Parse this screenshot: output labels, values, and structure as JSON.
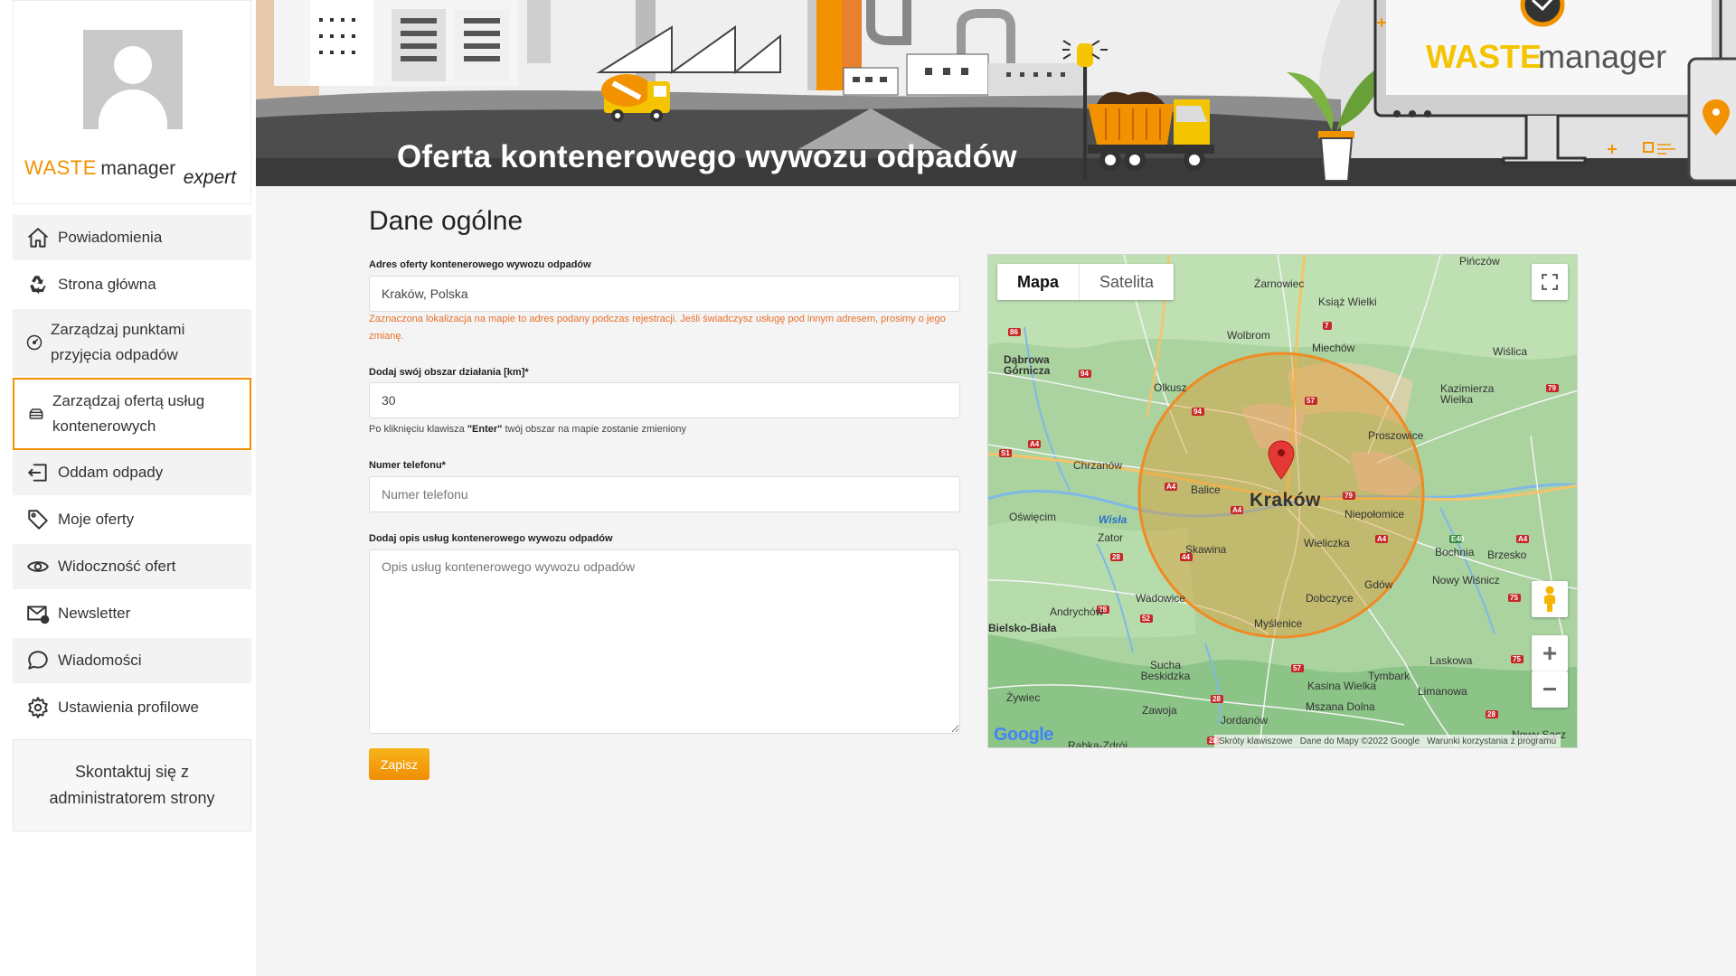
{
  "sidebar": {
    "logo": {
      "waste": "WASTE",
      "manager": "manager",
      "expert": "expert"
    },
    "items": [
      {
        "label": "Powiadomienia",
        "icon": "home-icon"
      },
      {
        "label": "Strona główna",
        "icon": "recycle-icon"
      },
      {
        "label": "Zarządzaj punktami przyjęcia odpadów",
        "icon": "gauge-icon"
      },
      {
        "label": "Zarządzaj ofertą usług kontenerowych",
        "icon": "container-icon",
        "active": true
      },
      {
        "label": "Oddam odpady",
        "icon": "box-arrow-icon"
      },
      {
        "label": "Moje oferty",
        "icon": "tag-icon"
      },
      {
        "label": "Widoczność ofert",
        "icon": "eye-icon"
      },
      {
        "label": "Newsletter",
        "icon": "envelope-icon"
      },
      {
        "label": "Wiadomości",
        "icon": "chat-bubble-icon"
      },
      {
        "label": "Ustawienia profilowe",
        "icon": "gear-icon"
      }
    ],
    "contact": "Skontaktuj się z administratorem strony"
  },
  "banner": {
    "title": "Oferta kontenerowego wywozu odpadów",
    "brand_waste": "WASTE",
    "brand_manager": "manager"
  },
  "form": {
    "section_title": "Dane ogólne",
    "address_label": "Adres oferty kontenerowego wywozu odpadów",
    "address_value": "Kraków, Polska",
    "address_note": "Zaznaczona lokalizacja na mapie to adres podany podczas rejestracji. Jeśli świadczysz usługę pod innym adresem, prosimy o jego zmianę.",
    "radius_label": "Dodaj swój obszar działania [km]*",
    "radius_value": "30",
    "radius_note_pre": "Po kliknięciu klawisza ",
    "radius_note_key": "\"Enter\"",
    "radius_note_post": " twój obszar na mapie zostanie zmieniony",
    "phone_label": "Numer telefonu*",
    "phone_placeholder": "Numer telefonu",
    "desc_label": "Dodaj opis usług kontenerowego wywozu odpadów",
    "desc_placeholder": "Opis usług kontenerowego wywozu odpadów",
    "save_label": "Zapisz"
  },
  "map": {
    "tab_map": "Mapa",
    "tab_satellite": "Satelita",
    "center_label": "Kraków",
    "google": "Google",
    "footer": [
      "Skróty klawiszowe",
      "Dane do Mapy ©2022 Google",
      "Warunki korzystania z programu"
    ],
    "places": [
      "Pińczów",
      "Żarnowiec",
      "Książ Wielki",
      "Wolbrom",
      "Miechów",
      "Wiślica",
      "Dąbrowa Górnicza",
      "Olkusz",
      "Kazimierza Wielka",
      "Proszowice",
      "Chrzanów",
      "Balice",
      "Oświęcim",
      "Wisła",
      "Zator",
      "Skawina",
      "Wieliczka",
      "Niepołomice",
      "Bochnia",
      "Brzesko",
      "Nowy Wiśnicz",
      "Gdów",
      "Wadowice",
      "Dobczyce",
      "Andrychów",
      "Myślenice",
      "Sucha Beskidzka",
      "Laskowa",
      "Tymbark",
      "Kasina Wielka",
      "Limanowa",
      "Żywiec",
      "Zawoja",
      "Mszana Dolna",
      "Jordanów",
      "Nowy Sącz",
      "Rabka-Zdrój",
      "Bielsko-Biała"
    ],
    "radius_km": 30,
    "colors": {
      "circle_fill": "#d3a64a",
      "circle_stroke": "#f08a24",
      "marker": "#e53935"
    }
  },
  "colors": {
    "accent": "#f39200",
    "orange_text": "#e8702a"
  }
}
